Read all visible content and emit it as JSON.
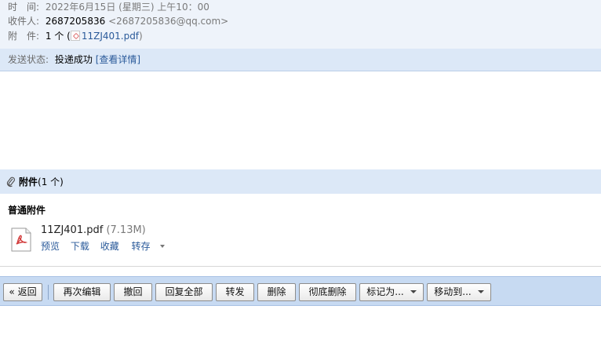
{
  "header": {
    "time_label": "时　间:",
    "time_value": "2022年6月15日 (星期三) 上午10：00",
    "to_label": "收件人:",
    "to_name": "2687205836",
    "to_email": "<2687205836@qq.com>",
    "attach_label": "附　件:",
    "attach_count": "1 个 (",
    "attach_file": "11ZJ401.pdf",
    "attach_close": ")"
  },
  "status": {
    "label": "发送状态:",
    "value": "投递成功",
    "details_link": "[查看详情]"
  },
  "attachments": {
    "title": "附件",
    "count": "(1 个)",
    "section_title": "普通附件",
    "file": {
      "name": "11ZJ401.pdf",
      "size": "(7.13M)",
      "icon": "pdf-file-icon",
      "actions": [
        "预览",
        "下载",
        "收藏",
        "转存"
      ]
    }
  },
  "toolbar": {
    "back": "« 返回",
    "re_edit": "再次编辑",
    "recall": "撤回",
    "reply_all": "回复全部",
    "forward": "转发",
    "delete": "删除",
    "delete_permanent": "彻底删除",
    "mark_as": "标记为...",
    "move_to": "移动到..."
  },
  "colors": {
    "link": "#2a5a9a",
    "header_bg": "#eef3fa",
    "bar_bg": "#dce8f7",
    "toolbar_bg": "#c7daf2",
    "pdf_red": "#d23b3b"
  }
}
